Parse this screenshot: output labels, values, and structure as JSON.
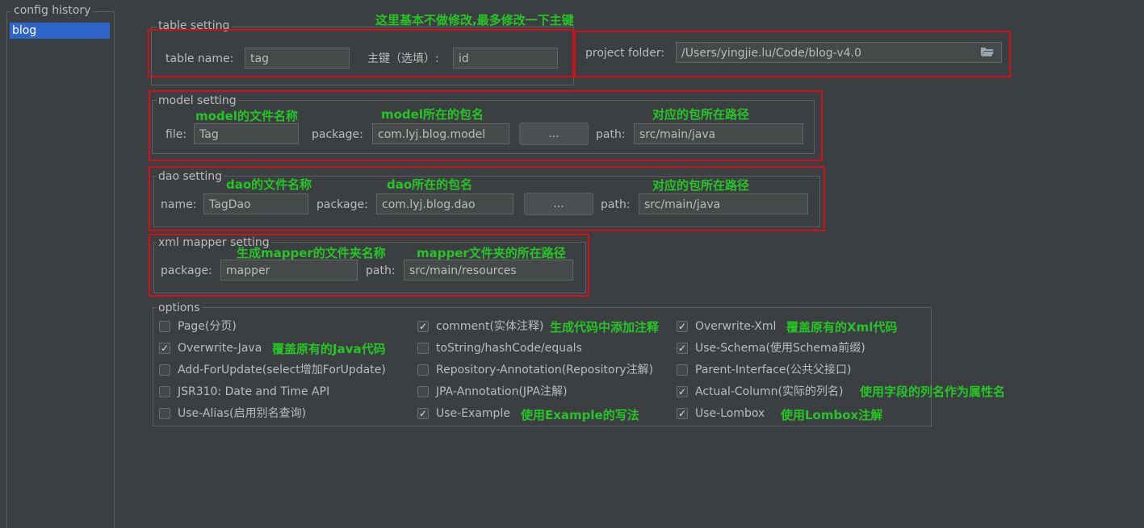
{
  "history": {
    "title": "config history",
    "items": [
      "blog"
    ]
  },
  "table": {
    "title": "table setting",
    "name_label": "table  name:",
    "name_value": "tag",
    "pk_label": "主键（选填）:",
    "pk_value": "id",
    "folder_label": "project folder:",
    "folder_value": "/Users/yingjie.lu/Code/blog-v4.0",
    "folder_icon": "folder-open-icon"
  },
  "model": {
    "title": "model setting",
    "file_label": "file:",
    "file_value": "Tag",
    "package_label": "package:",
    "package_value": "com.lyj.blog.model",
    "browse_label": "...",
    "path_label": "path:",
    "path_value": "src/main/java"
  },
  "dao": {
    "title": "dao setting",
    "name_label": "name:",
    "name_value": "TagDao",
    "package_label": "package:",
    "package_value": "com.lyj.blog.dao",
    "browse_label": "...",
    "path_label": "path:",
    "path_value": "src/main/java"
  },
  "xml": {
    "title": "xml mapper setting",
    "package_label": "package:",
    "package_value": "mapper",
    "path_label": "path:",
    "path_value": "src/main/resources"
  },
  "options": {
    "title": "options",
    "items": [
      {
        "label": "Page(分页)",
        "checked": false
      },
      {
        "label": "comment(实体注释)",
        "checked": true
      },
      {
        "label": "Overwrite-Xml",
        "checked": true
      },
      {
        "label": "Overwrite-Java",
        "checked": true
      },
      {
        "label": "toString/hashCode/equals",
        "checked": false
      },
      {
        "label": "Use-Schema(使用Schema前缀)",
        "checked": true
      },
      {
        "label": "Add-ForUpdate(select增加ForUpdate)",
        "checked": false
      },
      {
        "label": "Repository-Annotation(Repository注解)",
        "checked": false
      },
      {
        "label": "Parent-Interface(公共父接口)",
        "checked": false
      },
      {
        "label": "JSR310: Date and Time API",
        "checked": false
      },
      {
        "label": "JPA-Annotation(JPA注解)",
        "checked": false
      },
      {
        "label": "Actual-Column(实际的列名)",
        "checked": true
      },
      {
        "label": "Use-Alias(启用别名查询)",
        "checked": false
      },
      {
        "label": "Use-Example",
        "checked": true
      },
      {
        "label": "Use-Lombox",
        "checked": true
      }
    ]
  },
  "annotations": {
    "table_note": "这里基本不做修改,最多修改一下主键",
    "model_file_note": "model的文件名称",
    "model_package_note": "model所在的包名",
    "model_path_note": "对应的包所在路径",
    "dao_name_note": "dao的文件名称",
    "dao_package_note": "dao所在的包名",
    "dao_path_note": "对应的包所在路径",
    "xml_package_note": "生成mapper的文件夹名称",
    "xml_path_note": "mapper文件夹的所在路径",
    "comment_note": "生成代码中添加注释",
    "overwrite_xml_note": "覆盖原有的Xml代码",
    "overwrite_java_note": "覆盖原有的Java代码",
    "actual_column_note": "使用字段的列名作为属性名",
    "use_example_note": "使用Example的写法",
    "use_lombox_note": "使用Lombox注解"
  },
  "colors": {
    "background": "#3c3f41",
    "highlight_border": "#d0101b",
    "annotation_text": "#26c526",
    "selection": "#2f65ca"
  }
}
